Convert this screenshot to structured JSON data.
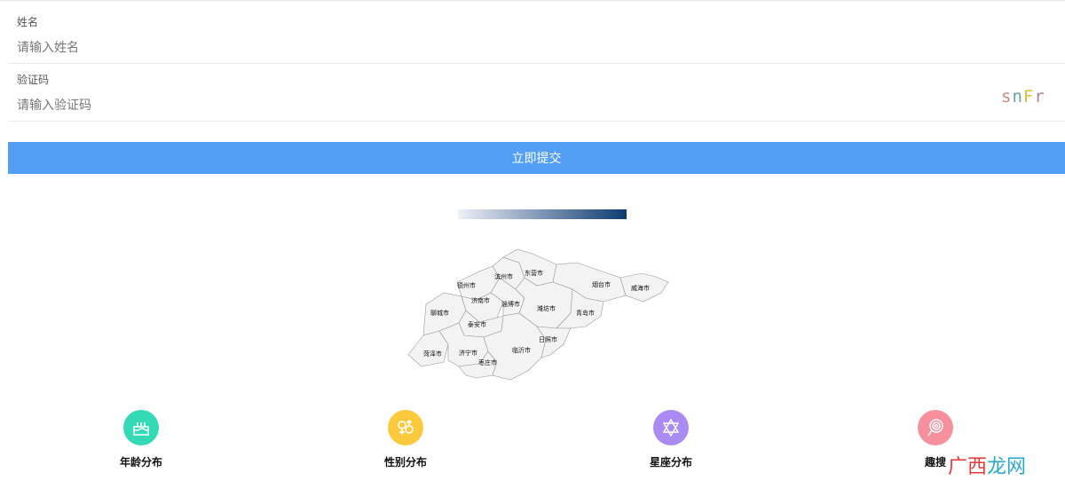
{
  "form": {
    "name_label": "姓名",
    "name_placeholder": "请输入姓名",
    "code_label": "验证码",
    "code_placeholder": "请输入验证码",
    "captcha": [
      {
        "ch": "s",
        "color": "#c98a7a"
      },
      {
        "ch": "n",
        "color": "#6aa7a0"
      },
      {
        "ch": "F",
        "color": "#d7c23c"
      },
      {
        "ch": "r",
        "color": "#b07fa6"
      }
    ],
    "submit_label": "立即提交"
  },
  "map": {
    "region_fill": "#f3f3f3",
    "border_color": "#999999",
    "legend_colors": [
      "#eef0f8",
      "#0d3b70"
    ],
    "cities": [
      {
        "id": "dezhou",
        "name": "德州市"
      },
      {
        "id": "binzhou",
        "name": "滨州市"
      },
      {
        "id": "dongying",
        "name": "东营市"
      },
      {
        "id": "yantai",
        "name": "烟台市"
      },
      {
        "id": "weihai",
        "name": "威海市"
      },
      {
        "id": "jinan",
        "name": "济南市"
      },
      {
        "id": "zibo",
        "name": "淄博市"
      },
      {
        "id": "weifang",
        "name": "潍坊市"
      },
      {
        "id": "liaocheng",
        "name": "聊城市"
      },
      {
        "id": "qingdao",
        "name": "青岛市"
      },
      {
        "id": "taian",
        "name": "泰安市"
      },
      {
        "id": "rizhao",
        "name": "日照市"
      },
      {
        "id": "heze",
        "name": "菏泽市"
      },
      {
        "id": "jining",
        "name": "济宁市"
      },
      {
        "id": "linyi",
        "name": "临沂市"
      },
      {
        "id": "zaozhuang",
        "name": "枣庄市"
      }
    ]
  },
  "stats": [
    {
      "label": "年龄分布",
      "icon": "birthday-cake-icon",
      "color": "#34d9b5"
    },
    {
      "label": "性别分布",
      "icon": "gender-icon",
      "color": "#fbc93c"
    },
    {
      "label": "星座分布",
      "icon": "star-of-david-icon",
      "color": "#a98bf2"
    },
    {
      "label": "趣搜",
      "icon": "lollipop-icon",
      "color": "#f5909c"
    }
  ],
  "watermark": {
    "part1": "广西",
    "part2": "龙网",
    "color1": "#e23a3a",
    "color2": "#2aa6c8"
  }
}
